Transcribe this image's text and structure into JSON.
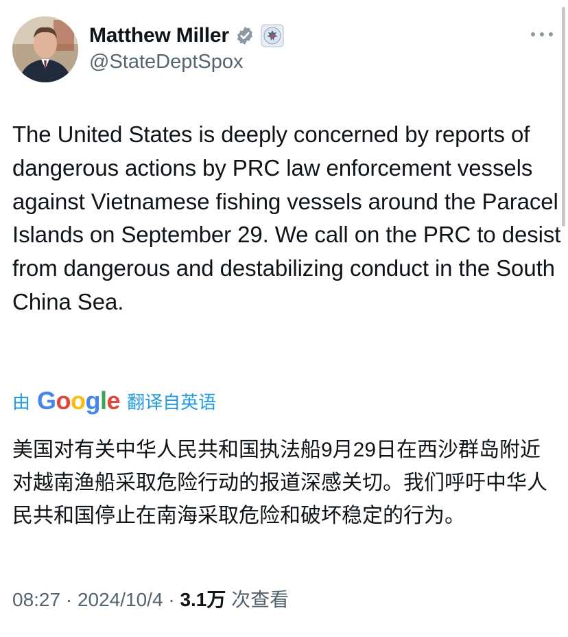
{
  "author": {
    "display_name": "Matthew Miller",
    "handle": "@StateDeptSpox",
    "verified_icon": "verified-badge-icon",
    "affiliation_icon": "state-department-seal-icon"
  },
  "tweet": {
    "text": "The United States is deeply concerned by reports of dangerous actions by PRC law enforcement vessels against Vietnamese fishing vessels around the Paracel Islands on September 29. We call on the PRC to desist from dangerous and destabilizing conduct in the South China Sea."
  },
  "translation": {
    "prefix": "由",
    "provider": "Google",
    "suffix": "翻译自英语",
    "text": "美国对有关中华人民共和国执法船9月29日在西沙群岛附近对越南渔船采取危险行动的报道深感关切。我们呼吁中华人民共和国停止在南海采取危险和破坏稳定的行为。"
  },
  "meta": {
    "time": "08:27",
    "separator": " · ",
    "date": "2024/10/4",
    "views_count": "3.1万",
    "views_label": " 次查看"
  },
  "colors": {
    "link_blue": "#1d9bf0",
    "muted_gray": "#536471",
    "text_black": "#0f1419"
  }
}
